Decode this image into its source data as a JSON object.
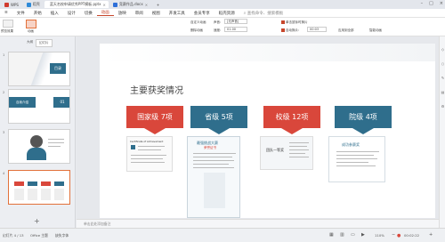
{
  "tabs": [
    {
      "label": "WPS",
      "color": "#d03a2e"
    },
    {
      "label": "稻壳",
      "color": "#2e8ad8"
    },
    {
      "label": "蓝天名校申请优秀PPT模板.pptx",
      "color": "#e0612c",
      "active": true
    },
    {
      "label": "竞赛作品.docx",
      "color": "#2e6fd8"
    }
  ],
  "menus": [
    "文件",
    "开始",
    "插入",
    "设计",
    "切换",
    "动画",
    "放映",
    "审阅",
    "视图",
    "开发工具",
    "会员专享",
    "稻壳资源"
  ],
  "active_menu": "动画",
  "search_placeholder": "查找命令、搜索模板",
  "toolbar": {
    "preview": "预览效果",
    "animation": "动画",
    "custom_anim": "自定义动画",
    "delete_anim": "删除动画",
    "sound_label": "声音:",
    "sound_value": "[无声音]",
    "speed_label": "速度:",
    "speed_value": "01.00",
    "mouse_click": "单击鼠标时换片",
    "auto_switch": "自动换片:",
    "auto_value": "00:03",
    "apply_all": "应用到全部",
    "morph": "智能动画"
  },
  "panel": {
    "tab_outline": "大纲",
    "tab_slides": "幻灯片",
    "thumb1_text": "目录",
    "thumb2_text": "自我介绍",
    "thumb2_num": "01",
    "nums": [
      "1",
      "2",
      "3",
      "4"
    ]
  },
  "slide": {
    "title": "主要获奖情况",
    "boxes": [
      {
        "label": "国家级 7项",
        "color": "#d9473b"
      },
      {
        "label": "省级 5项",
        "color": "#2f6e8c"
      },
      {
        "label": "校级 12项",
        "color": "#d9473b"
      },
      {
        "label": "院级 4项",
        "color": "#2f6e8c"
      }
    ],
    "cert1_title": "Certificate of Achievement",
    "cert2_title": "最强挑战大赛",
    "cert2_sub": "荣誉证书",
    "cert3_title": "团队一等奖",
    "cert4_title": "成功参赛奖"
  },
  "notes_placeholder": "单击此处添加备注",
  "status": {
    "slide_count": "幻灯片 4 / 13",
    "theme": "Office 主题",
    "font_missing": "缺失字体",
    "zoom": "110%",
    "time": "00:02:22"
  },
  "colors": {
    "accent": "#c7462b",
    "red": "#d9473b",
    "teal": "#2f6e8c"
  }
}
